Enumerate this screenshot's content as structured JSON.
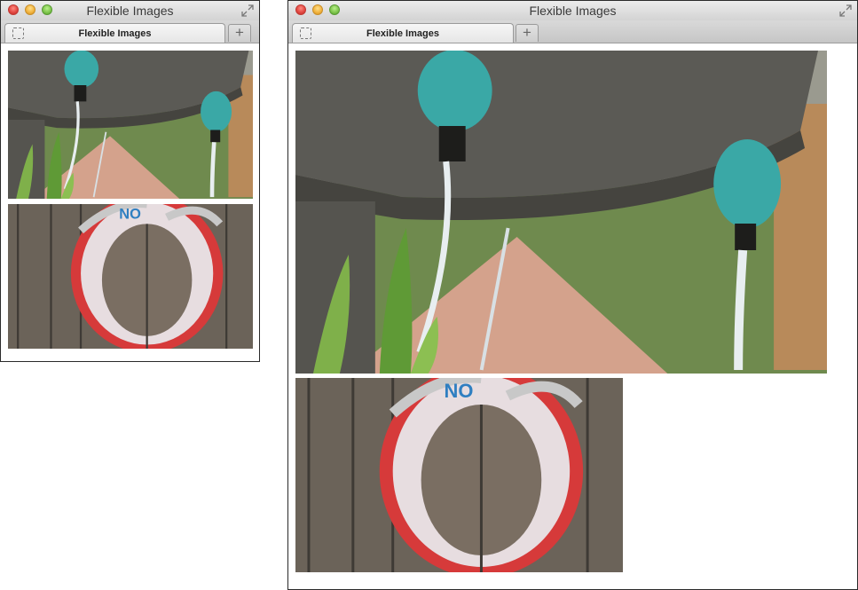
{
  "windows": [
    {
      "title": "Flexible Images",
      "tab_label": "Flexible Images",
      "new_tab_symbol": "+",
      "icons": [
        "close-light",
        "minimize-light",
        "zoom-light",
        "fullscreen-icon",
        "page-favicon-icon"
      ]
    },
    {
      "title": "Flexible Images",
      "tab_label": "Flexible Images",
      "new_tab_symbol": "+",
      "icons": [
        "close-light",
        "minimize-light",
        "zoom-light",
        "fullscreen-icon",
        "page-favicon-icon"
      ]
    }
  ],
  "images": {
    "fountain": {
      "subject": "stone fountain with teal lion-head spouts"
    },
    "lifering": {
      "subject": "red and white life ring on wooden fence",
      "lettering": "NO POINT"
    }
  },
  "colors": {
    "teal": "#3aa8a6",
    "ring_red": "#d63a3a",
    "stone": "#5f5e59",
    "wood": "#6b6359"
  }
}
